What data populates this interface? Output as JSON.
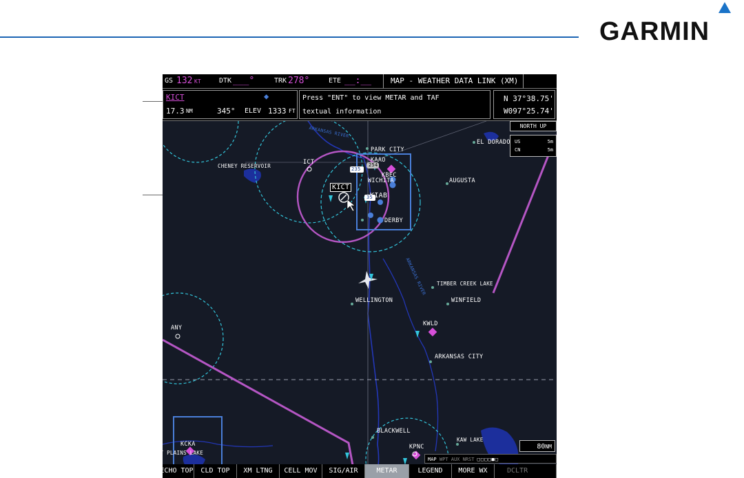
{
  "brand": {
    "name": "GARMIN",
    "mark": "triangle-logo-icon",
    "color": "#1a73c8"
  },
  "nav": {
    "gs_label": "GS",
    "gs_value": "132",
    "gs_unit": "KT",
    "dtk_label": "DTK",
    "dtk_value": "___°",
    "trk_label": "TRK",
    "trk_value": "278°",
    "ete_label": "ETE",
    "ete_value": "__:__",
    "page_title": "MAP - WEATHER DATA LINK (XM)"
  },
  "info": {
    "station_id": "KICT",
    "distance": "17.3",
    "distance_unit": "NM",
    "bearing": "345°",
    "elev_label": "ELEV",
    "elev_value": "1333",
    "elev_unit": "FT",
    "message_line1": "Press \"ENT\" to view METAR and TAF",
    "message_line2": "textual information",
    "lat": "N 37°38.75'",
    "lon": "W097°25.74'"
  },
  "map": {
    "orientation": "NORTH UP",
    "legend": [
      {
        "label": "US",
        "value": "5m"
      },
      {
        "label": "CN",
        "value": "5m"
      }
    ],
    "range": "80",
    "range_unit": "NM",
    "river_label_1": "ARKANSAS RIVER",
    "river_label_2": "ARKANSAS RIVER",
    "places": {
      "park_city": "PARK CITY",
      "el_dorado": "EL DORADO",
      "cheney": "CHENEY RESERVOIR",
      "ict": "ICT",
      "kaao": "KAAO",
      "kbec": "KBEC",
      "wichita": "WICHITA",
      "augusta": "AUGUSTA",
      "kict": "KICT",
      "kiab": "KIAB",
      "derby": "DERBY",
      "timber_creek": "TIMBER CREEK LAKE",
      "wellington": "WELLINGTON",
      "winfield": "WINFIELD",
      "kwld": "KWLD",
      "any": "ANY",
      "arkansas_city": "ARKANSAS CITY",
      "kcka": "KCKA",
      "salt_plains": "SALT PLAINS LAKE",
      "blackwell": "BLACKWELL",
      "kaw_lake": "KAW LAKE",
      "kpnc": "KPNC"
    },
    "hwy_235": "235",
    "hwy_254": "254",
    "hwy_35": "35"
  },
  "page_group": {
    "active": "MAP",
    "others": "WPT AUX NRST"
  },
  "softkeys": [
    {
      "label": "ECHO TOP",
      "state": "normal"
    },
    {
      "label": "CLD TOP",
      "state": "normal"
    },
    {
      "label": "XM LTNG",
      "state": "normal"
    },
    {
      "label": "CELL MOV",
      "state": "normal"
    },
    {
      "label": "SIG/AIR",
      "state": "normal"
    },
    {
      "label": "METAR",
      "state": "active"
    },
    {
      "label": "LEGEND",
      "state": "normal"
    },
    {
      "label": "MORE WX",
      "state": "normal"
    },
    {
      "label": "DCLTR",
      "state": "disabled"
    }
  ],
  "colors": {
    "map_background": "#151a26",
    "magenta": "#d64fd9",
    "cyan": "#33c6dc",
    "water": "#1c2f9c",
    "airspace_blue": "#4a7fd9",
    "active_softkey": "#9aa0a8"
  }
}
